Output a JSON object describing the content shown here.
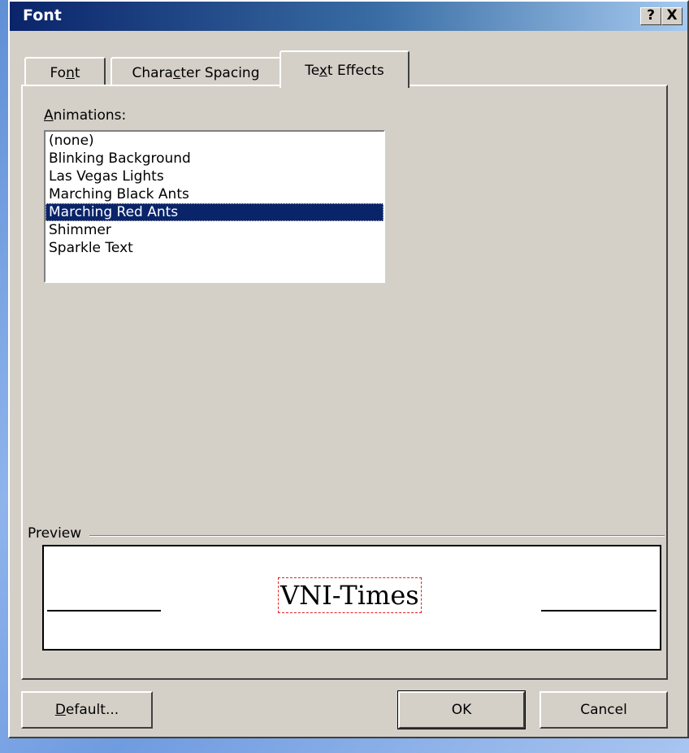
{
  "window": {
    "title": "Font",
    "help_glyph": "?",
    "close_glyph": "X"
  },
  "tabs": [
    {
      "pre": "Fo",
      "mnemonic": "n",
      "post": "t",
      "active": false
    },
    {
      "pre": "Chara",
      "mnemonic": "c",
      "post": "ter Spacing",
      "active": false
    },
    {
      "pre": "Te",
      "mnemonic": "x",
      "post": "t Effects",
      "active": true
    }
  ],
  "animations": {
    "label_mnemonic": "A",
    "label_rest": "nimations:",
    "items": [
      "(none)",
      "Blinking Background",
      "Las Vegas Lights",
      "Marching Black Ants",
      "Marching Red Ants",
      "Shimmer",
      "Sparkle Text"
    ],
    "selected": "Marching Red Ants"
  },
  "preview": {
    "label": "Preview",
    "sample_text": "VNI-Times"
  },
  "buttons": {
    "default_mnemonic": "D",
    "default_rest": "efault...",
    "ok": "OK",
    "cancel": "Cancel"
  }
}
